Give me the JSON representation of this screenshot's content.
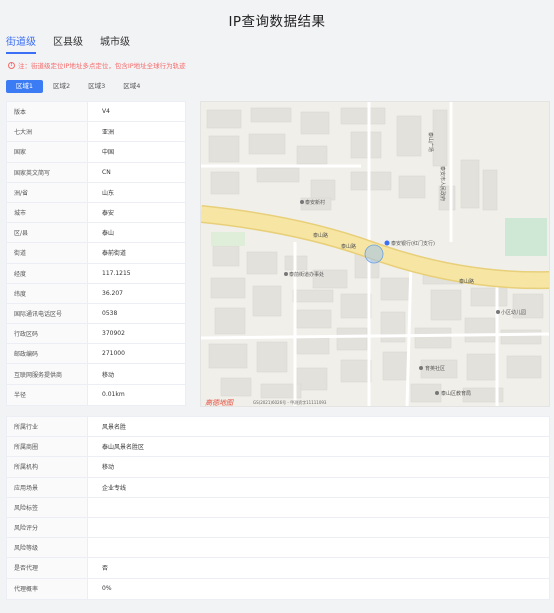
{
  "title": "IP查询数据结果",
  "level_tabs": [
    "街道级",
    "区县级",
    "城市级"
  ],
  "notice": "注：街道级定位IP地址多点定位，包含IP地址全球行为轨迹",
  "region_tabs": [
    "区域1",
    "区域2",
    "区域3",
    "区域4"
  ],
  "info_rows": [
    {
      "key": "版本",
      "value": "V4"
    },
    {
      "key": "七大洲",
      "value": "亚洲"
    },
    {
      "key": "国家",
      "value": "中国"
    },
    {
      "key": "国家英文简写",
      "value": "CN"
    },
    {
      "key": "洲/省",
      "value": "山东"
    },
    {
      "key": "城市",
      "value": "泰安"
    },
    {
      "key": "区/县",
      "value": "泰山"
    },
    {
      "key": "街道",
      "value": "泰前街道"
    },
    {
      "key": "经度",
      "value": "117.1215"
    },
    {
      "key": "纬度",
      "value": "36.207"
    },
    {
      "key": "国际通讯电话区号",
      "value": "0538"
    },
    {
      "key": "行政区码",
      "value": "370902"
    },
    {
      "key": "邮政编码",
      "value": "271000"
    },
    {
      "key": "互联网服务提供商",
      "value": "移动"
    },
    {
      "key": "半径",
      "value": "0.01km"
    }
  ],
  "map": {
    "labels": {
      "road_a": "泰山路",
      "road_b": "泰山路",
      "road_c": "泰山路",
      "poi_1": "泰安银行(红门支行)",
      "poi_2": "泰前街道办事处",
      "poi_3": "泰安新村",
      "poi_4": "泰安市人民政府",
      "poi_5": "小区幼儿园",
      "poi_6": "育英社区",
      "poi_7": "泰山区教育局",
      "poi_8": "泰山广场",
      "logo": "高德地图",
      "copyright": "GS(2021)6026号 - 甲测资字11111093"
    }
  },
  "bottom_rows": [
    {
      "key": "所属行业",
      "value": "风景名胜"
    },
    {
      "key": "所属商圈",
      "value": "泰山风景名胜区"
    },
    {
      "key": "所属机构",
      "value": "移动"
    },
    {
      "key": "应用场景",
      "value": "企业专线"
    },
    {
      "key": "风险标签",
      "value": ""
    },
    {
      "key": "风险评分",
      "value": ""
    },
    {
      "key": "风险等级",
      "value": ""
    },
    {
      "key": "是否代理",
      "value": "否"
    },
    {
      "key": "代理概率",
      "value": "0%"
    }
  ],
  "colors": {
    "accent": "#3b6ff5",
    "notice": "#f56c6c",
    "road": "#f7e6a3"
  }
}
